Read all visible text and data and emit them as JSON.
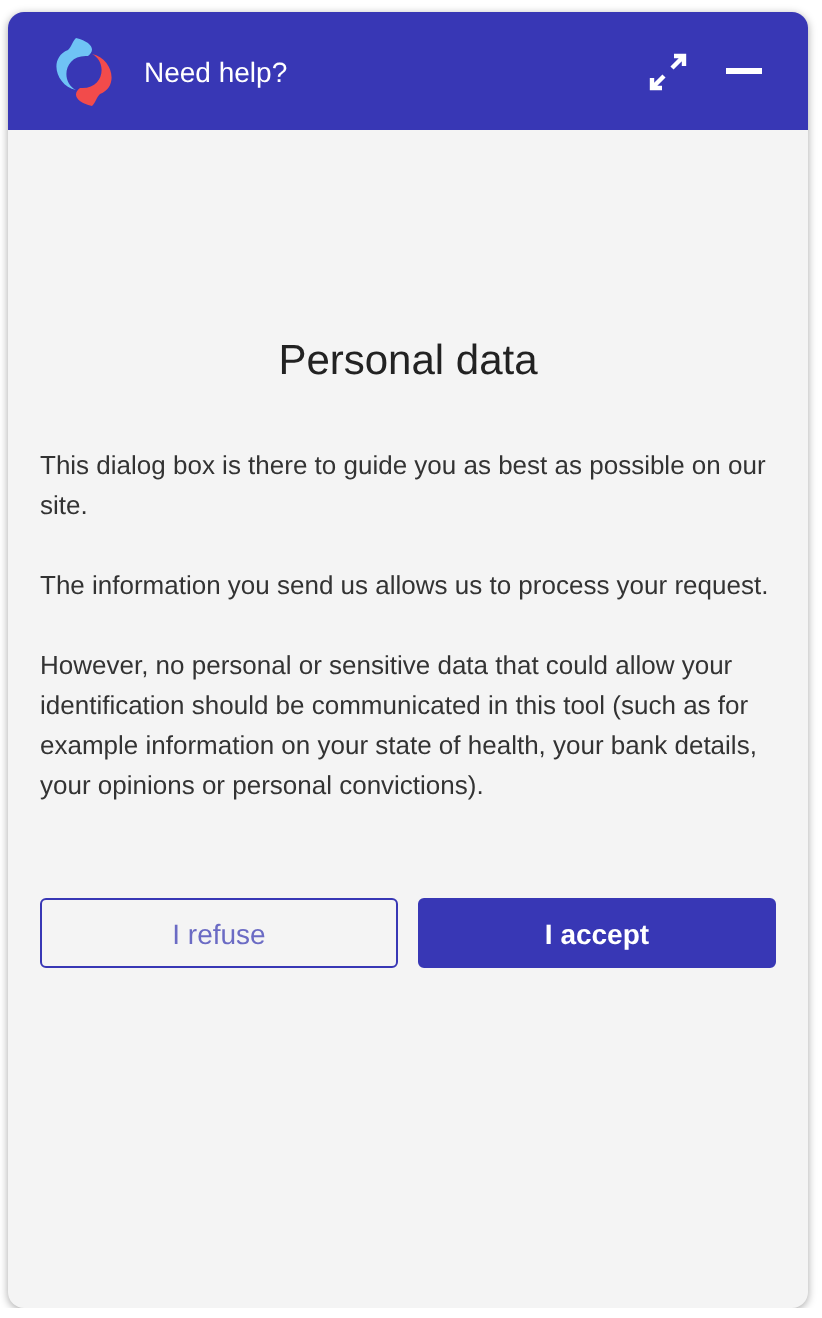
{
  "header": {
    "title": "Need help?"
  },
  "dialog": {
    "title": "Personal data",
    "paragraphs": [
      "This dialog box is there to guide you as best as possible on our site.",
      "The information you send us allows us to process your request.",
      "However, no personal or sensitive data that could allow your identification should be communicated in this tool (such as for example information on your state of health, your bank details, your opinions or personal convictions)."
    ],
    "buttons": [
      {
        "label": "I refuse",
        "kind": "outline"
      },
      {
        "label": "I accept",
        "kind": "filled"
      }
    ]
  }
}
